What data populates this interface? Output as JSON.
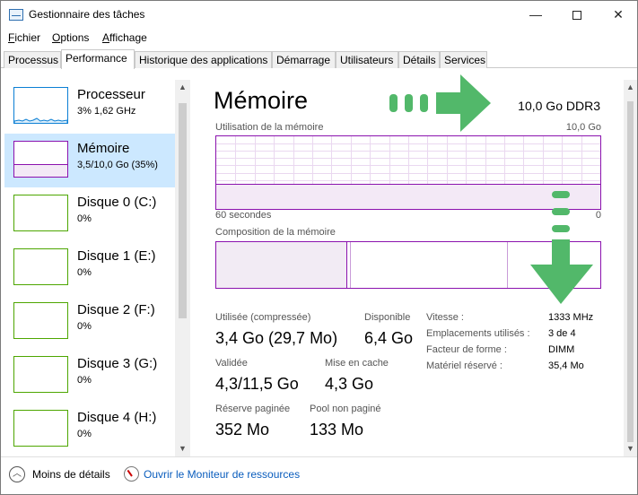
{
  "window": {
    "title": "Gestionnaire des tâches",
    "controls": {
      "minimize": "—",
      "close": "✕"
    }
  },
  "menu": [
    {
      "pre": "",
      "u": "F",
      "post": "ichier"
    },
    {
      "pre": "",
      "u": "O",
      "post": "ptions"
    },
    {
      "pre": "",
      "u": "A",
      "post": "ffichage"
    }
  ],
  "tabs": [
    "Processus",
    "Performance",
    "Historique des applications",
    "Démarrage",
    "Utilisateurs",
    "Détails",
    "Services"
  ],
  "active_tab": "Performance",
  "sidebar": {
    "items": [
      {
        "name": "Processeur",
        "value": "3% 1,62 GHz"
      },
      {
        "name": "Mémoire",
        "value": "3,5/10,0 Go (35%)"
      },
      {
        "name": "Disque 0 (C:)",
        "value": "0%"
      },
      {
        "name": "Disque 1 (E:)",
        "value": "0%"
      },
      {
        "name": "Disque 2 (F:)",
        "value": "0%"
      },
      {
        "name": "Disque 3 (G:)",
        "value": "0%"
      },
      {
        "name": "Disque 4 (H:)",
        "value": "0%"
      }
    ],
    "selected_index": 1,
    "scroll_up": "▲",
    "scroll_down": "▼"
  },
  "main": {
    "title": "Mémoire",
    "spec": "10,0 Go DDR3",
    "usage_graph": {
      "label": "Utilisation de la mémoire",
      "max": "10,0 Go",
      "left_axis": "60 secondes",
      "right_axis": "0",
      "fraction_used": 0.35
    },
    "composition": {
      "label": "Composition de la mémoire",
      "used_fraction": 0.34,
      "modified_fraction": 0.01,
      "standby_fraction": 0.41
    },
    "stats": [
      {
        "label": "Utilisée (compressée)",
        "value": "3,4 Go (29,7 Mo)"
      },
      {
        "label": "Disponible",
        "value": "6,4 Go"
      },
      {
        "label": "Validée",
        "value": "4,3/11,5 Go"
      },
      {
        "label": "Mise en cache",
        "value": "4,3 Go"
      },
      {
        "label": "Réserve paginée",
        "value": "352 Mo"
      },
      {
        "label": "Pool non paginé",
        "value": "133 Mo"
      }
    ],
    "details": [
      {
        "label": "Vitesse :",
        "value": "1333 MHz"
      },
      {
        "label": "Emplacements utilisés :",
        "value": "3 de 4"
      },
      {
        "label": "Facteur de forme :",
        "value": "DIMM"
      },
      {
        "label": "Matériel réservé :",
        "value": "35,4 Mo"
      }
    ]
  },
  "bottom": {
    "fewer_details": "Moins de détails",
    "fewer_icon": "︿",
    "resource_monitor": "Ouvrir le Moniteur de ressources"
  },
  "colors": {
    "memory_accent": "#8b12ae",
    "cpu_accent": "#0b7fd4",
    "disk_accent": "#4da600",
    "selected_bg": "#cce8ff",
    "annotation_green": "#52b86a"
  }
}
